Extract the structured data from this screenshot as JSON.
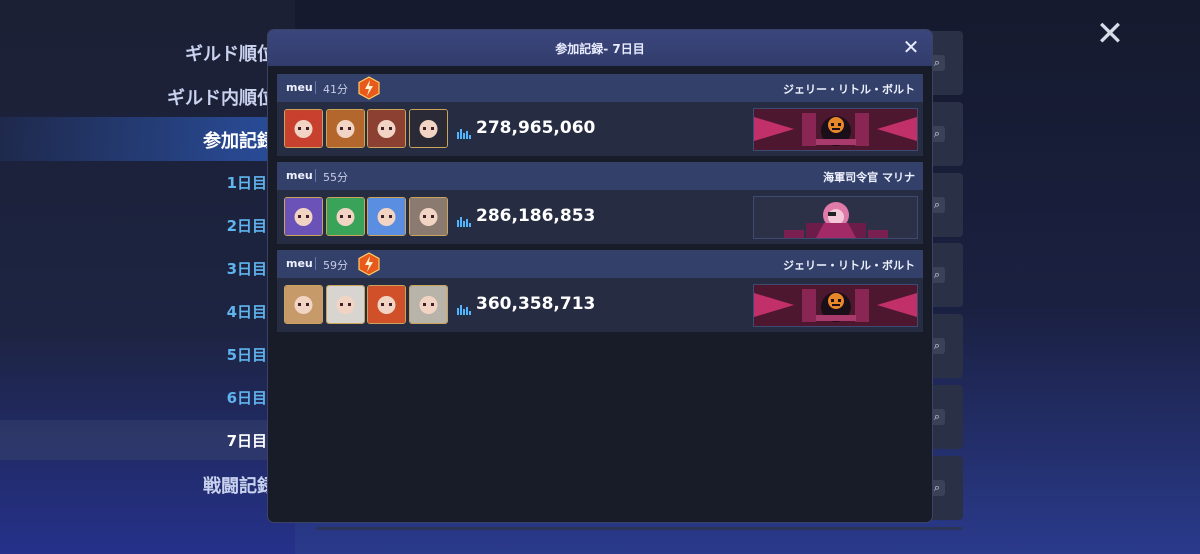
{
  "sidebar": {
    "items": [
      {
        "label": "ギルド順位"
      },
      {
        "label": "ギルド内順位"
      },
      {
        "label": "参加記録"
      }
    ],
    "days": [
      {
        "label": "1日目"
      },
      {
        "label": "2日目"
      },
      {
        "label": "3日目"
      },
      {
        "label": "4日目"
      },
      {
        "label": "5日目"
      },
      {
        "label": "6日目"
      },
      {
        "label": "7日目"
      }
    ],
    "battle_label": "戦闘記録"
  },
  "modal": {
    "title": "参加記録- 7日目",
    "close_icon": "close-icon"
  },
  "entries": [
    {
      "player": "meu",
      "duration": "41分",
      "has_bolt": true,
      "boss": "ジェリー・リトル・ボルト",
      "score": "278,965,060",
      "boss_variant": "jerry",
      "chars": [
        "#c8402e",
        "#b4672c",
        "#8c4032",
        "#2a2a36"
      ]
    },
    {
      "player": "meu",
      "duration": "55分",
      "has_bolt": false,
      "boss": "海軍司令官 マリナ",
      "score": "286,186,853",
      "boss_variant": "marina",
      "chars": [
        "#6a52b8",
        "#3aa35a",
        "#5a8ee0",
        "#8a7a70"
      ]
    },
    {
      "player": "meu",
      "duration": "59分",
      "has_bolt": true,
      "boss": "ジェリー・リトル・ボルト",
      "score": "360,358,713",
      "boss_variant": "jerry",
      "chars": [
        "#c79a6a",
        "#d8d4d0",
        "#d0502a",
        "#b9b4aa"
      ]
    }
  ],
  "colors": {
    "accent": "#4fb6ff",
    "header": "#33406a",
    "body": "#262c42",
    "bolt_fill": "#e85a1c"
  }
}
